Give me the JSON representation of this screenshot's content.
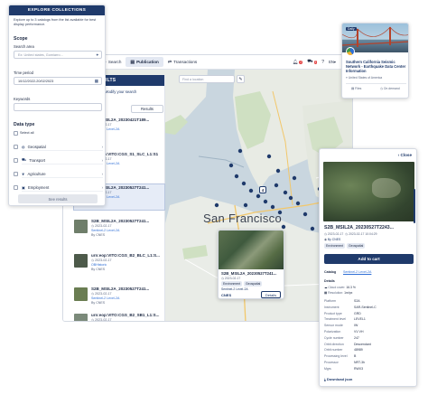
{
  "colors": {
    "navy": "#1f3a6b",
    "accent": "#2f6fd6",
    "water": "#c9d6df",
    "land": "#e8ebe6"
  },
  "topbar": {
    "tabs": [
      {
        "label": "Search",
        "icon": "search-icon"
      },
      {
        "label": "Publication",
        "icon": "book-icon"
      },
      {
        "label": "Transactions",
        "icon": "transfer-icon"
      }
    ],
    "badge_1": "2",
    "badge_2": "3",
    "language": "EN",
    "language_caret": "▾"
  },
  "map": {
    "search_placeholder": "Find a location",
    "city_label": "San Francisco",
    "cluster_count": "4"
  },
  "results": {
    "header": "SEARCH RESULTS",
    "modify_link": "Modify your search",
    "results_button": "Results",
    "items": [
      {
        "title": "S2B_MSIL2A_20230421T189...",
        "date": "2023-02-17",
        "level": "Sentinel-2 Level-2A",
        "provider": "By CNES",
        "color": "#2c3440",
        "selected": false
      },
      {
        "title": "urn:eop:VITO:CGS_S1_SLC_L1:S1",
        "date": "2023-02-17",
        "level": "Sentinel-2 Level-2A",
        "provider": "By CNES",
        "color": "#5b6a78",
        "selected": false
      },
      {
        "title": "S2B_MSIL2A_20230527T241...",
        "date": "2023-02-17",
        "level": "Sentinel-2 Level-2A",
        "provider": "By CNES",
        "color": "#3a5d7a",
        "selected": true
      },
      {
        "title": "S2B_MSIL2A_20230527T241...",
        "date": "2023-02-17",
        "level": "Sentinel-2 Level-2A",
        "provider": "By CNES",
        "color": "#6f7e6a",
        "selected": false
      },
      {
        "title": "urn:eop:VITO:CGS_B2_BLC_L1:S...",
        "date": "2023-02-17",
        "level": "OBHistoric",
        "provider": "By CNES",
        "color": "#4d5a4a",
        "selected": false
      },
      {
        "title": "S2B_MSIL2A_20230527T241...",
        "date": "2023-02-17",
        "level": "Sentinel-2 Level-2A",
        "provider": "By CNES",
        "color": "#6a7d52",
        "selected": false
      },
      {
        "title": "urn:eop:VITO:CGS_B2_SB1_L1:S...",
        "date": "2023-02-17",
        "level": "OBHistoric",
        "provider": "By CNES",
        "color": "#7b8a7a",
        "selected": false
      }
    ]
  },
  "collections": {
    "header": "EXPLORE COLLECTIONS",
    "intro": "Explore up to 3 catalogs from the list available for best display performance.",
    "scope_title": "Scope",
    "search_area_label": "Search area",
    "search_area_placeholder": "Ex: United states, Gomiarro...",
    "time_period_label": "Time period",
    "time_period_value": "10/12/2022-20/02/2023",
    "keywords_label": "Keywords",
    "data_type_title": "Data type",
    "select_all": "Select all",
    "categories": [
      {
        "label": "Geospatial",
        "icon": "globe-icon"
      },
      {
        "label": "Transport",
        "icon": "truck-icon"
      },
      {
        "label": "Agriculture",
        "icon": "leaf-icon"
      },
      {
        "label": "Employment",
        "icon": "briefcase-icon"
      }
    ],
    "see_results": "See results"
  },
  "dataset_card": {
    "tag": "Daily",
    "title": "Southern California Seismic Network - Earthquake Data Center Information",
    "location": "United States of America",
    "files_label": "Files",
    "delivery_label": "On demand"
  },
  "detail_panel": {
    "close_label": "Close",
    "title": "S2B_MSIL2A_20230527T2243...",
    "date": "2023-02-17",
    "date_end": "2023-02-17 10:04:29",
    "provider": "By CNES",
    "tags": [
      "Environment",
      "Geospatial"
    ],
    "add_to_cart": "Add to cart",
    "catalog_label": "Catalog",
    "catalog_value": "Sentinel-2 Level-2A",
    "details_label": "Details",
    "details_rows": [
      {
        "label": "Cloud cover:",
        "value": "16.3 %"
      },
      {
        "label": "Resolution:",
        "value": "1m/px"
      }
    ],
    "attributes": [
      {
        "k": "Platform",
        "v": "S2A"
      },
      {
        "k": "Instrument",
        "v": "SAR-Sentinel-C"
      },
      {
        "k": "Product type",
        "v": "GRD"
      },
      {
        "k": "Treatment level",
        "v": "LEVEL1"
      },
      {
        "k": "Sensor mode",
        "v": "IW"
      },
      {
        "k": "Polarization",
        "v": "VV VH"
      },
      {
        "k": "Cycle number",
        "v": "247"
      },
      {
        "k": "Orbit direction",
        "v": "Descendant"
      },
      {
        "k": "Orbit number",
        "v": "48989"
      },
      {
        "k": "Processing level",
        "v": "B"
      },
      {
        "k": "Processor",
        "v": "NRT-3h"
      },
      {
        "k": "Mgrs",
        "v": "RWX3"
      }
    ],
    "download_json": "Download json"
  },
  "map_popup": {
    "title": "S2B_MSIL2A_20230527T241...",
    "date": "2023-02-17",
    "tags": [
      "Environment",
      "Geospatial"
    ],
    "level": "Sentinel-2 Level-2A",
    "provider_logo": "CNES",
    "details_button": "Details"
  }
}
